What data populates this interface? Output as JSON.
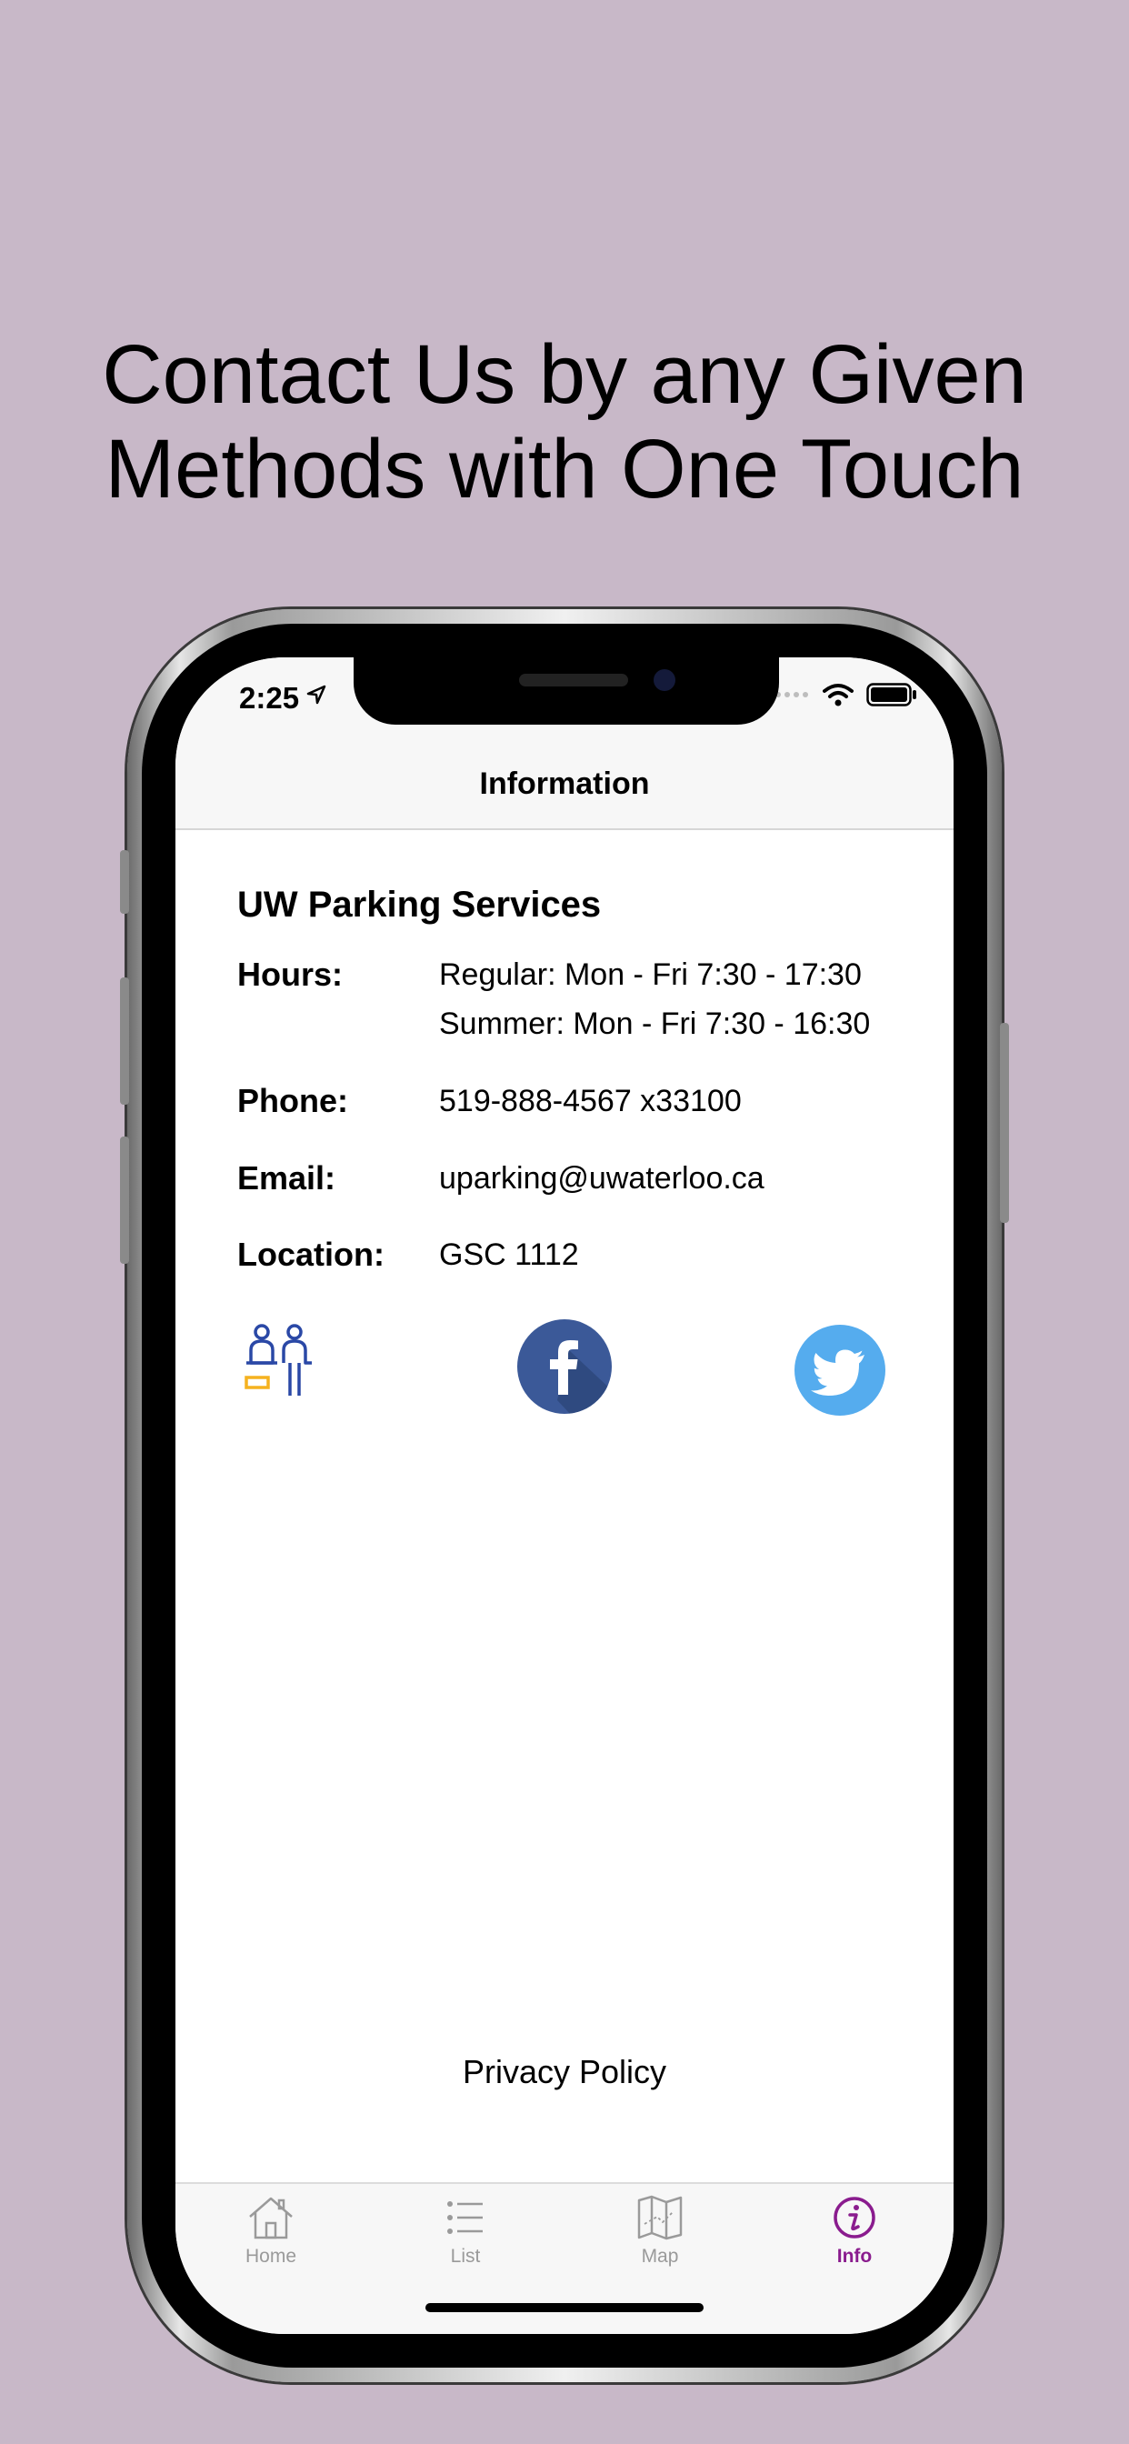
{
  "headline": {
    "line1": "Contact Us by any Given",
    "line2": "Methods with One Touch"
  },
  "status_bar": {
    "time": "2:25"
  },
  "nav": {
    "title": "Information"
  },
  "info": {
    "org_name": "UW Parking Services",
    "hours_label": "Hours:",
    "hours_regular": "Regular: Mon - Fri 7:30 - 17:30",
    "hours_summer": "Summer: Mon - Fri 7:30 - 16:30",
    "phone_label": "Phone:",
    "phone_value": "519-888-4567 x33100",
    "email_label": "Email:",
    "email_value": "uparking@uwaterloo.ca",
    "location_label": "Location:",
    "location_value": "GSC 1112"
  },
  "contact_icons": [
    "front-desk-icon",
    "facebook-icon",
    "twitter-icon"
  ],
  "footer": {
    "privacy_label": "Privacy Policy"
  },
  "tabs": [
    {
      "label": "Home",
      "icon": "home-icon",
      "active": false
    },
    {
      "label": "List",
      "icon": "list-icon",
      "active": false
    },
    {
      "label": "Map",
      "icon": "map-icon",
      "active": false
    },
    {
      "label": "Info",
      "icon": "info-icon",
      "active": true
    }
  ],
  "colors": {
    "background": "#c8b8c8",
    "accent": "#8a1c8e",
    "facebook": "#3b5998",
    "twitter": "#55acee",
    "desk_blue": "#2a48a6",
    "desk_orange": "#f5b21f"
  }
}
